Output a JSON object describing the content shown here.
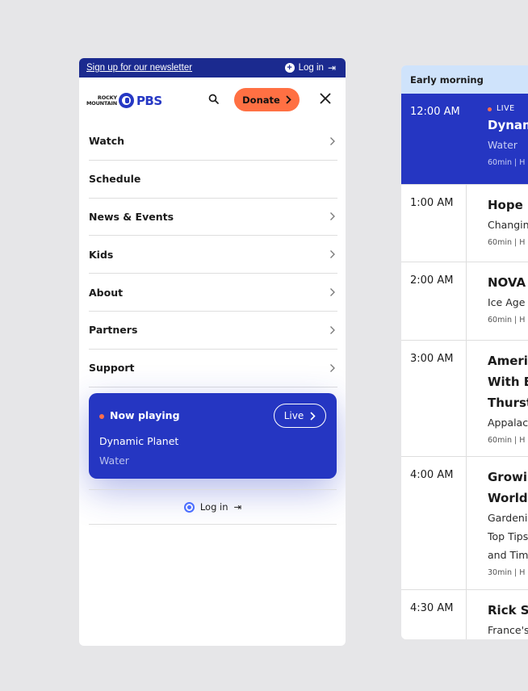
{
  "mobile_menu": {
    "newsletter_link": "Sign up for our newsletter",
    "top_login_label": "Log in",
    "logo_station_line1": "ROCKY",
    "logo_station_line2": "MOUNTAIN",
    "logo_brand": "PBS",
    "donate_label": "Donate",
    "nav_items": [
      {
        "label": "Watch",
        "has_chevron": true
      },
      {
        "label": "Schedule",
        "has_chevron": false
      },
      {
        "label": "News & Events",
        "has_chevron": true
      },
      {
        "label": "Kids",
        "has_chevron": true
      },
      {
        "label": "About",
        "has_chevron": true
      },
      {
        "label": "Partners",
        "has_chevron": true
      },
      {
        "label": "Support",
        "has_chevron": true
      }
    ],
    "now_playing": {
      "label": "Now playing",
      "live_button": "Live",
      "show": "Dynamic Planet",
      "episode": "Water"
    },
    "bottom_login_label": "Log in"
  },
  "schedule": {
    "section_label": "Early morning",
    "live_tag": "LIVE",
    "rows": [
      {
        "time": "12:00 AM",
        "title_lines": [
          "Dynam"
        ],
        "subtitle_lines": [
          "Water"
        ],
        "meta": "60min | H",
        "live": true
      },
      {
        "time": "1:00 AM",
        "title_lines": [
          "Hope i"
        ],
        "subtitle_lines": [
          "Changin"
        ],
        "meta": "60min | H",
        "live": false
      },
      {
        "time": "2:00 AM",
        "title_lines": [
          "NOVA"
        ],
        "subtitle_lines": [
          "Ice Age"
        ],
        "meta": "60min | H",
        "live": false
      },
      {
        "time": "3:00 AM",
        "title_lines": [
          "Americ",
          "With B",
          "Thurst"
        ],
        "subtitle_lines": [
          "Appalac"
        ],
        "meta": "60min | H",
        "live": false
      },
      {
        "time": "4:00 AM",
        "title_lines": [
          "Growin",
          "World"
        ],
        "subtitle_lines": [
          "Gardeni",
          "Top Tips",
          "and Tim"
        ],
        "meta": "30min | H",
        "live": false
      },
      {
        "time": "4:30 AM",
        "title_lines": [
          "Rick St"
        ],
        "subtitle_lines": [
          "France's"
        ],
        "meta": "",
        "live": false
      }
    ]
  },
  "colors": {
    "brand_blue": "#2536c2",
    "newsletter_bar": "#1b2a8f",
    "donate_orange": "#ff7043",
    "live_dot": "#ff6d4d",
    "schedule_header": "#cfe3fb"
  }
}
